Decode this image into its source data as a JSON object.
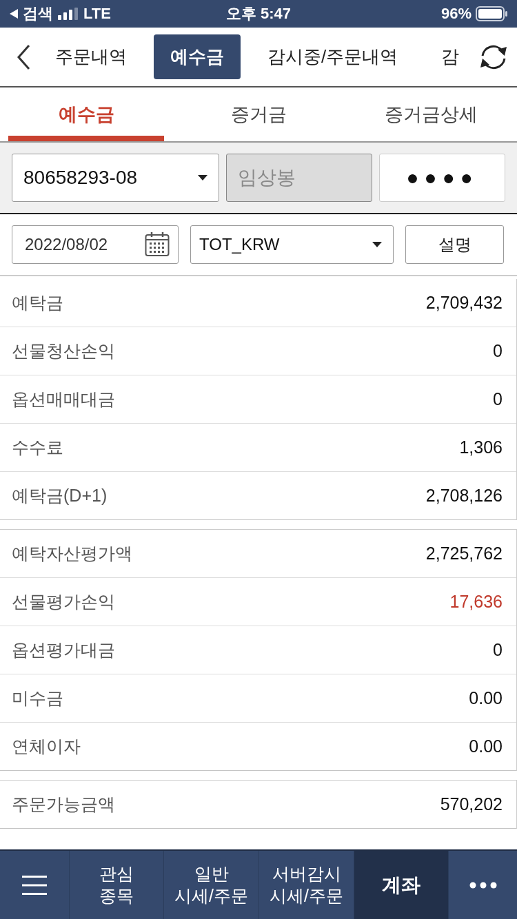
{
  "status_bar": {
    "back_label": "검색",
    "network": "LTE",
    "time": "오후 5:47",
    "battery": "96%"
  },
  "top_tabs": [
    {
      "label": "주문내역",
      "selected": false
    },
    {
      "label": "예수금",
      "selected": true
    },
    {
      "label": "감시중/주문내역",
      "selected": false
    },
    {
      "label": "감",
      "selected": false
    }
  ],
  "sub_tabs": [
    {
      "label": "예수금",
      "selected": true
    },
    {
      "label": "증거금",
      "selected": false
    },
    {
      "label": "증거금상세",
      "selected": false
    }
  ],
  "account": {
    "number": "80658293-08",
    "name": "임상봉",
    "name_disabled": true,
    "password_mask": "●●●●"
  },
  "query": {
    "date": "2022/08/02",
    "currency": "TOT_KRW",
    "button": "설명"
  },
  "groups": [
    {
      "rows": [
        {
          "label": "예탁금",
          "value": "2,709,432",
          "color": "#111111"
        },
        {
          "label": "선물청산손익",
          "value": "0",
          "color": "#111111"
        },
        {
          "label": "옵션매매대금",
          "value": "0",
          "color": "#111111"
        },
        {
          "label": "수수료",
          "value": "1,306",
          "color": "#111111"
        },
        {
          "label": "예탁금(D+1)",
          "value": "2,708,126",
          "color": "#111111"
        }
      ]
    },
    {
      "rows": [
        {
          "label": "예탁자산평가액",
          "value": "2,725,762",
          "color": "#111111"
        },
        {
          "label": "선물평가손익",
          "value": "17,636",
          "color": "#c0392b"
        },
        {
          "label": "옵션평가대금",
          "value": "0",
          "color": "#111111"
        },
        {
          "label": "미수금",
          "value": "0.00",
          "color": "#111111"
        },
        {
          "label": "연체이자",
          "value": "0.00",
          "color": "#111111"
        }
      ]
    },
    {
      "rows": [
        {
          "label": "주문가능금액",
          "value": "570,202",
          "color": "#111111"
        }
      ]
    }
  ],
  "bottom_nav": [
    {
      "kind": "menu",
      "selected": false
    },
    {
      "kind": "text",
      "lines": [
        "관심",
        "종목"
      ],
      "selected": false
    },
    {
      "kind": "text",
      "lines": [
        "일반",
        "시세/주문"
      ],
      "selected": false
    },
    {
      "kind": "text",
      "lines": [
        "서버감시",
        "시세/주문"
      ],
      "selected": false
    },
    {
      "kind": "text",
      "lines": [
        "계좌"
      ],
      "selected": true
    },
    {
      "kind": "more",
      "selected": false
    }
  ]
}
